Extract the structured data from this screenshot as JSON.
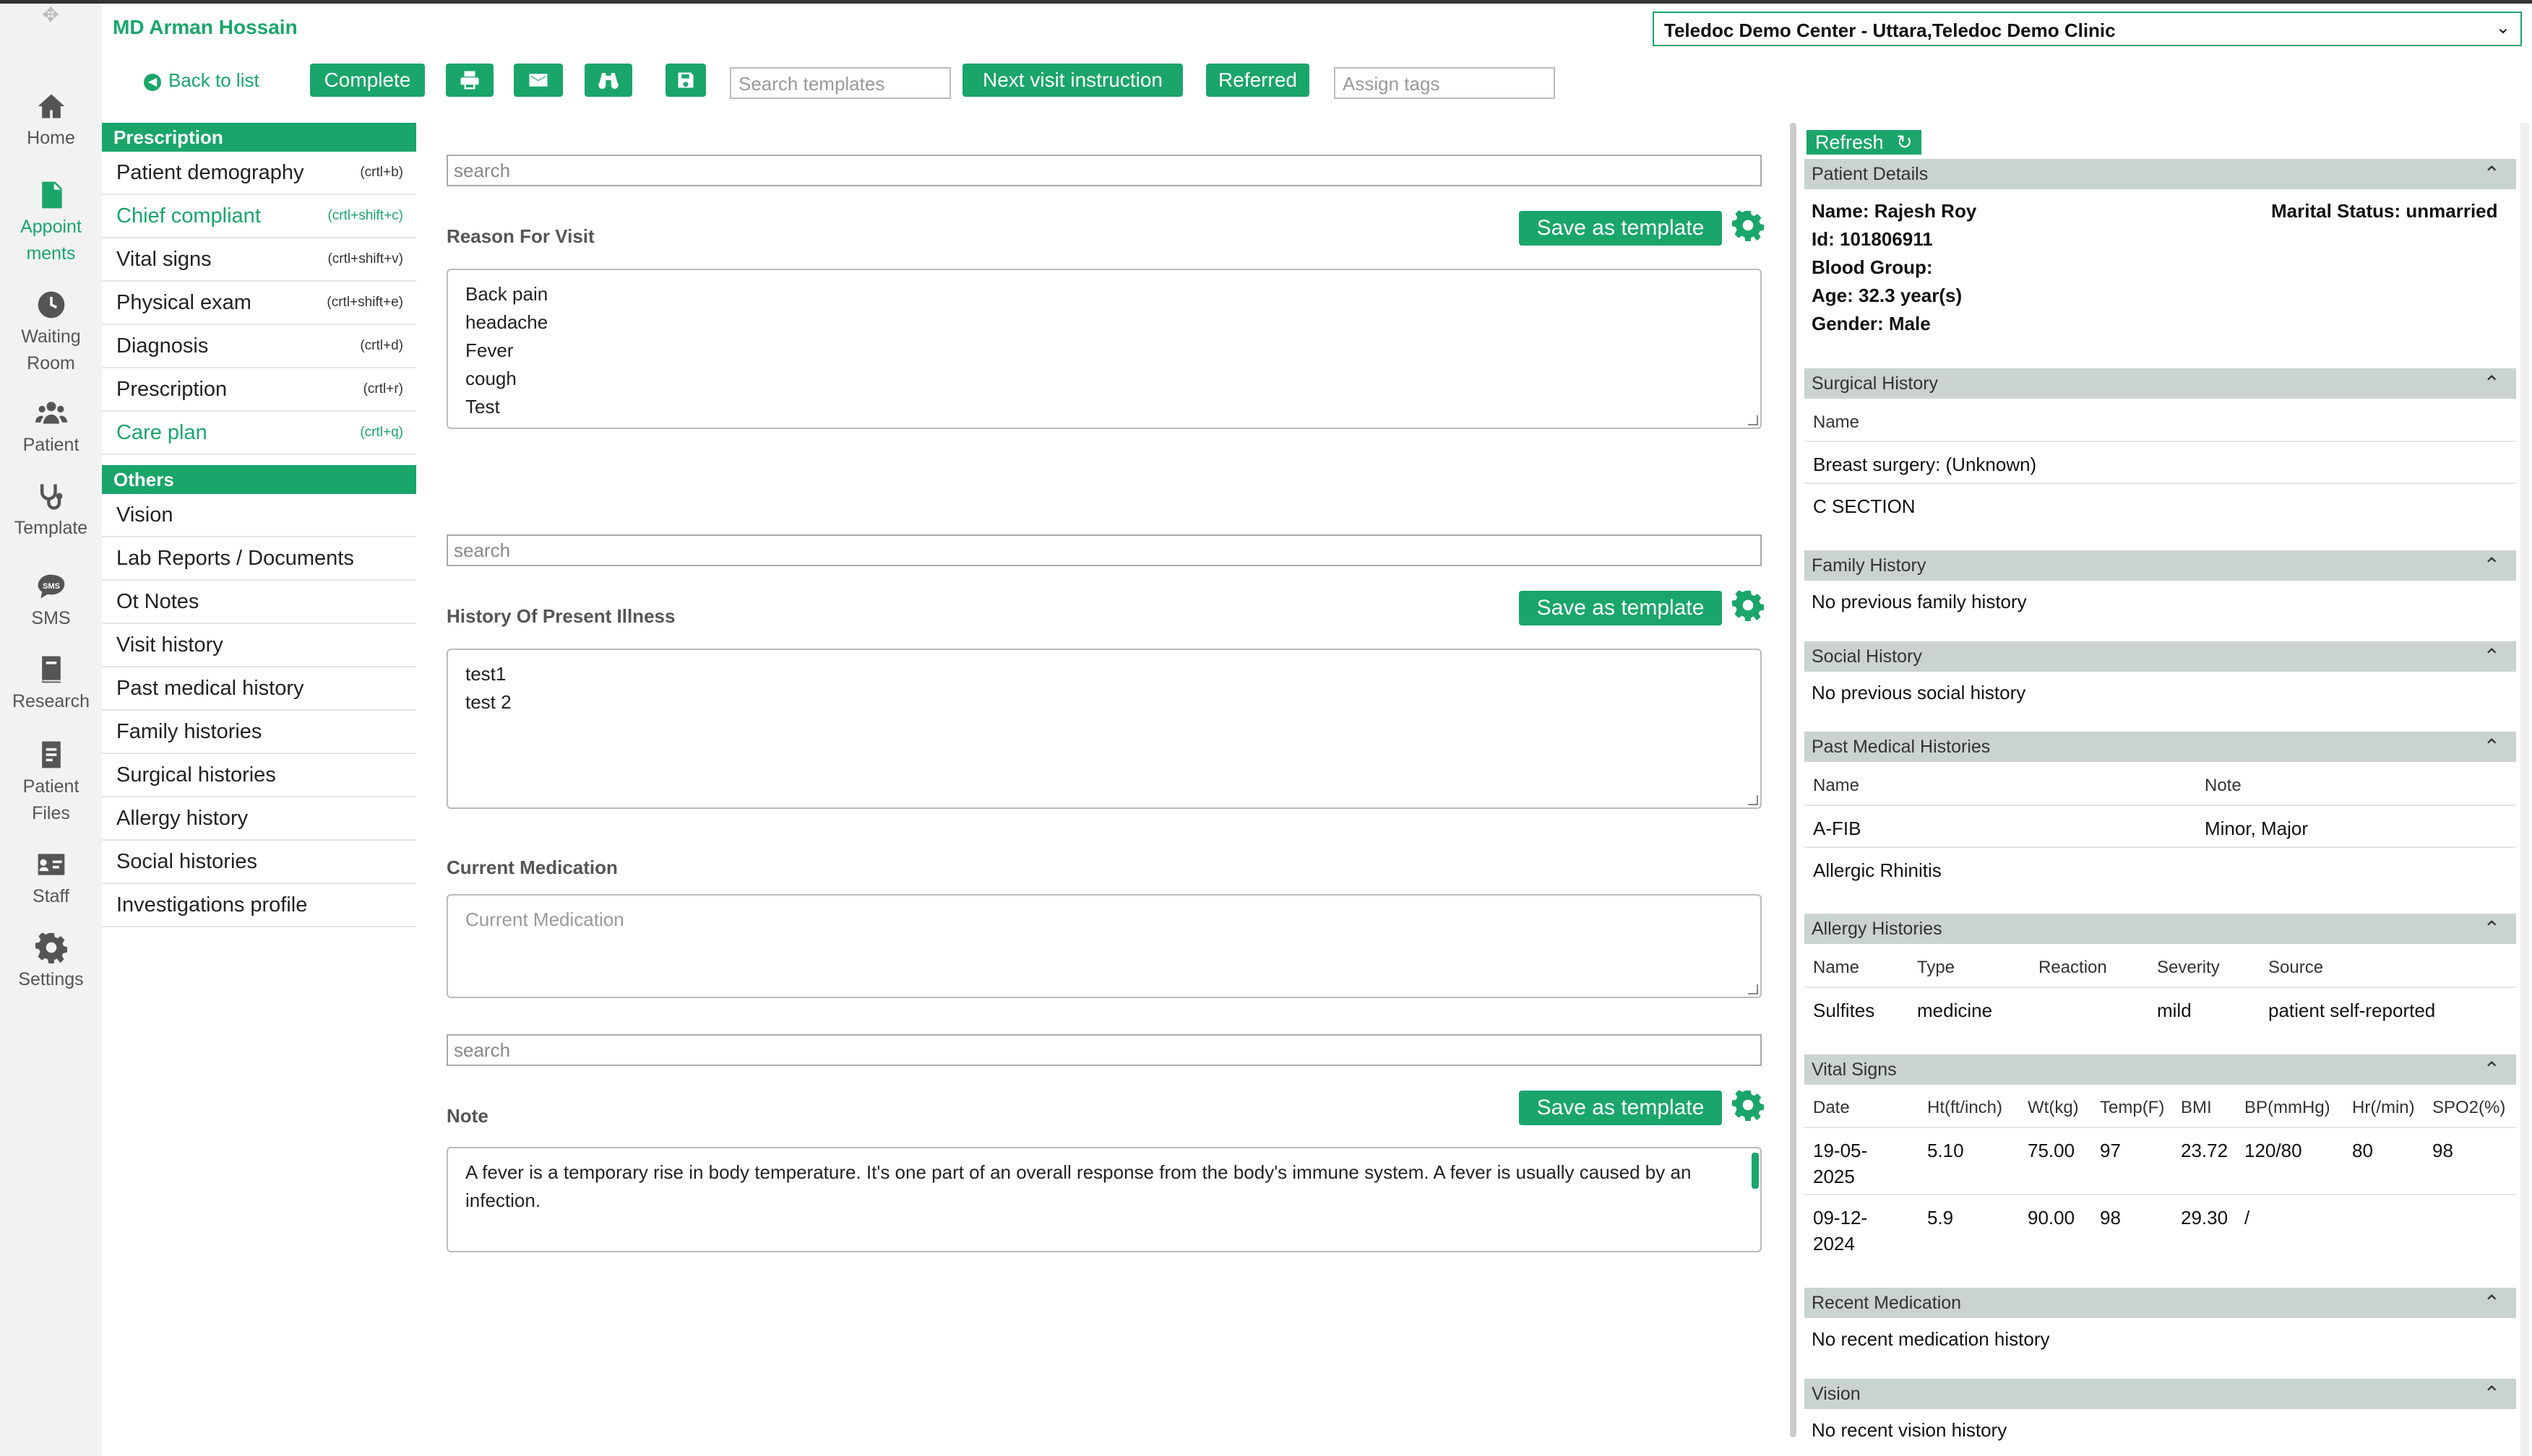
{
  "header": {
    "doctor_name": "MD Arman Hossain",
    "clinic": "Teledoc Demo Center - Uttara,Teledoc Demo Clinic"
  },
  "rail": [
    {
      "label_lines": [
        "Home"
      ],
      "icon": "home-icon"
    },
    {
      "label_lines": [
        "Appoint",
        "ments"
      ],
      "icon": "document-icon",
      "active": true
    },
    {
      "label_lines": [
        "Waiting",
        "Room"
      ],
      "icon": "clock-icon"
    },
    {
      "label_lines": [
        "Patient"
      ],
      "icon": "users-icon"
    },
    {
      "label_lines": [
        "Template"
      ],
      "icon": "stethoscope-icon"
    },
    {
      "label_lines": [
        "SMS"
      ],
      "icon": "sms-icon"
    },
    {
      "label_lines": [
        "Research"
      ],
      "icon": "book-icon"
    },
    {
      "label_lines": [
        "Patient",
        "Files"
      ],
      "icon": "file-icon"
    },
    {
      "label_lines": [
        "Staff"
      ],
      "icon": "id-card-icon"
    },
    {
      "label_lines": [
        "Settings"
      ],
      "icon": "gear-icon"
    }
  ],
  "toolbar": {
    "back": "Back to list",
    "complete": "Complete",
    "search_templates_placeholder": "Search templates",
    "next_visit": "Next visit instruction",
    "referred": "Referred",
    "assign_tags_placeholder": "Assign tags"
  },
  "nav": {
    "prescription_title": "Prescription",
    "prescription_items": [
      {
        "label": "Patient demography",
        "shortcut": "(crtl+b)"
      },
      {
        "label": "Chief compliant",
        "shortcut": "(crtl+shift+c)",
        "accent": true
      },
      {
        "label": "Vital signs",
        "shortcut": "(crtl+shift+v)"
      },
      {
        "label": "Physical exam",
        "shortcut": "(crtl+shift+e)"
      },
      {
        "label": "Diagnosis",
        "shortcut": "(crtl+d)"
      },
      {
        "label": "Prescription",
        "shortcut": "(crtl+r)"
      },
      {
        "label": "Care plan",
        "shortcut": "(crtl+q)",
        "accent": true
      }
    ],
    "others_title": "Others",
    "others_items": [
      "Vision",
      "Lab Reports / Documents",
      "Ot Notes",
      "Visit history",
      "Past medical history",
      "Family histories",
      "Surgical histories",
      "Allergy history",
      "Social histories",
      "Investigations profile"
    ]
  },
  "main": {
    "search_placeholder": "search",
    "save_template": "Save as template",
    "reason_title": "Reason For Visit",
    "reason_lines": [
      "Back pain",
      "headache",
      "Fever",
      "cough",
      "Test"
    ],
    "hpi_title": "History Of Present Illness",
    "hpi_lines": [
      "test1",
      "test 2"
    ],
    "current_med_title": "Current Medication",
    "current_med_placeholder": "Current Medication",
    "note_title": "Note",
    "note_text": "A fever is a temporary rise in body temperature. It's one part of an overall response from the body's immune system. A fever is usually caused by an infection."
  },
  "right": {
    "refresh": "Refresh",
    "patient_details_title": "Patient Details",
    "patient": {
      "name": "Name: Rajesh Roy",
      "marital": "Marital Status: unmarried",
      "id": "Id: 101806911",
      "blood": "Blood Group:",
      "age": "Age: 32.3 year(s)",
      "gender": "Gender: Male"
    },
    "surgical_title": "Surgical History",
    "surgical_col": "Name",
    "surgical_rows": [
      "Breast surgery: (Unknown)",
      "C SECTION"
    ],
    "family_title": "Family History",
    "family_text": "No previous family history",
    "social_title": "Social History",
    "social_text": "No previous social history",
    "pmh_title": "Past Medical Histories",
    "pmh_cols": [
      "Name",
      "Note"
    ],
    "pmh_rows": [
      [
        "A-FIB",
        "Minor, Major"
      ],
      [
        "Allergic Rhinitis",
        ""
      ]
    ],
    "allergy_title": "Allergy Histories",
    "allergy_cols": [
      "Name",
      "Type",
      "Reaction",
      "Severity",
      "Source"
    ],
    "allergy_rows": [
      [
        "Sulfites",
        "medicine",
        "",
        "mild",
        "patient self-reported"
      ]
    ],
    "vitals_title": "Vital Signs",
    "vitals_cols": [
      "Date",
      "Ht(ft/inch)",
      "Wt(kg)",
      "Temp(F)",
      "BMI",
      "BP(mmHg)",
      "Hr(/min)",
      "SPO2(%)"
    ],
    "vitals_rows": [
      [
        [
          "19-05-",
          "2025"
        ],
        "5.10",
        "75.00",
        "97",
        "23.72",
        "120/80",
        "80",
        "98"
      ],
      [
        [
          "09-12-",
          "2024"
        ],
        "5.9",
        "90.00",
        "98",
        "29.30",
        "/",
        "",
        ""
      ]
    ],
    "recent_med_title": "Recent Medication",
    "recent_med_text": "No recent medication history",
    "vision_title": "Vision",
    "vision_text": "No recent vision history"
  },
  "colors": {
    "accent": "#1aa56b",
    "panel_header": "#cbd3d0"
  }
}
